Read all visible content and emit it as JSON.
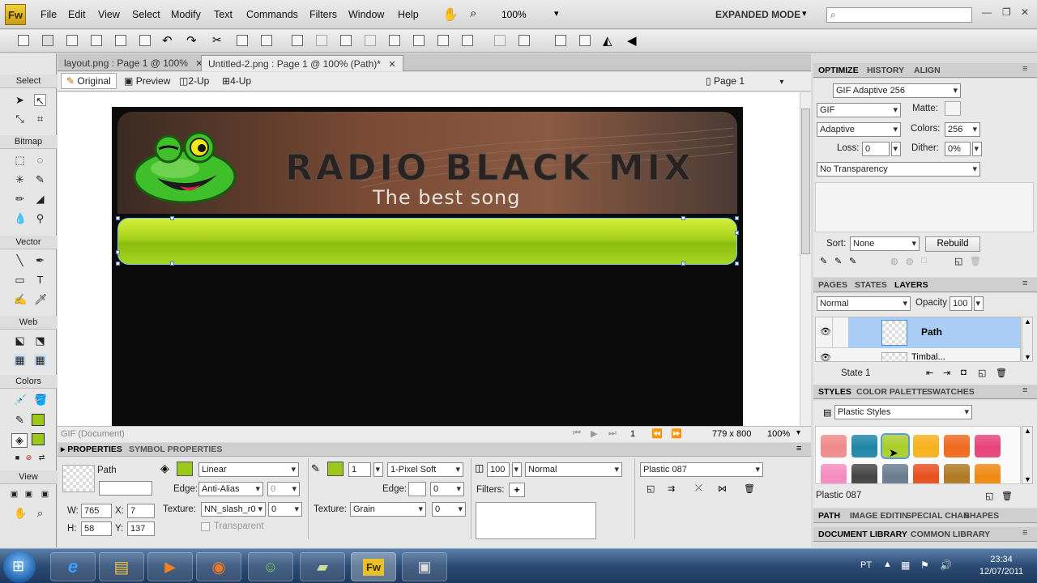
{
  "app": {
    "logo": "Fw",
    "mode": "EXPANDED MODE",
    "zoom": "100%"
  },
  "menu": [
    "File",
    "Edit",
    "View",
    "Select",
    "Modify",
    "Text",
    "Commands",
    "Filters",
    "Window",
    "Help"
  ],
  "tools": {
    "sections": [
      "Select",
      "Bitmap",
      "Vector",
      "Web",
      "Colors",
      "View"
    ]
  },
  "doc_tabs": [
    {
      "label": "layout.png : Page 1 @ 100%"
    },
    {
      "label": "Untitled-2.png : Page 1 @ 100% (Path)*"
    }
  ],
  "view_tabs": [
    "Original",
    "Preview",
    "2-Up",
    "4-Up"
  ],
  "page_selector": "Page 1",
  "canvas": {
    "title": "RADIO BLACK MIX",
    "subtitle": "The best song"
  },
  "status": {
    "type": "GIF (Document)",
    "page": "1",
    "size": "779 x 800",
    "zoom": "100%"
  },
  "properties": {
    "tabs": [
      "PROPERTIES",
      "SYMBOL PROPERTIES"
    ],
    "object": "Path",
    "w_label": "W:",
    "w": "765",
    "h_label": "H:",
    "h": "58",
    "x_label": "X:",
    "x": "7",
    "y_label": "Y:",
    "y": "137",
    "fill_type": "Linear",
    "edge_label": "Edge:",
    "edge": "Anti-Alias",
    "edge_val": "0",
    "texture_label": "Texture:",
    "texture": "NN_slash_r0",
    "texture_val": "0",
    "transparent": "Transparent",
    "stroke_size": "1",
    "stroke_type": "1-Pixel Soft",
    "stroke_edge_val": "0",
    "stroke_texture": "Grain",
    "stroke_texture_val": "0",
    "opacity": "100",
    "blend": "Normal",
    "filters_label": "Filters:",
    "style": "Plastic 087"
  },
  "optimize": {
    "tabs": [
      "OPTIMIZE",
      "HISTORY",
      "ALIGN"
    ],
    "preset": "GIF Adaptive 256",
    "format": "GIF",
    "matte_label": "Matte:",
    "palette": "Adaptive",
    "colors_label": "Colors:",
    "colors": "256",
    "loss_label": "Loss:",
    "loss": "0",
    "dither_label": "Dither:",
    "dither": "0%",
    "transparency": "No Transparency",
    "sort_label": "Sort:",
    "sort": "None",
    "rebuild": "Rebuild"
  },
  "layers": {
    "tabs": [
      "PAGES",
      "STATES",
      "LAYERS"
    ],
    "blend": "Normal",
    "opacity_label": "Opacity",
    "opacity": "100",
    "rows": [
      {
        "name": "Path"
      },
      {
        "name": "Timbal..."
      }
    ],
    "state": "State 1"
  },
  "styles": {
    "tabs": [
      "STYLES",
      "COLOR PALETTE",
      "SWATCHES"
    ],
    "set": "Plastic Styles",
    "selected": "Plastic 087",
    "row1": [
      "#f08a8a",
      "#1e86a8",
      "#a9cf2a",
      "#f7b21c",
      "#f06a1e",
      "#e6437a"
    ],
    "row2": [
      "#f58cc0",
      "#444444",
      "#6a7c90",
      "#e8501e",
      "#b07a22",
      "#f08a10"
    ]
  },
  "bottom_tabs": [
    "PATH",
    "IMAGE EDITIN",
    "SPECIAL CHAR",
    "SHAPES"
  ],
  "library_tabs": [
    "DOCUMENT LIBRARY",
    "COMMON LIBRARY"
  ],
  "taskbar": {
    "lang": "PT",
    "time": "23:34",
    "date": "12/07/2011"
  }
}
